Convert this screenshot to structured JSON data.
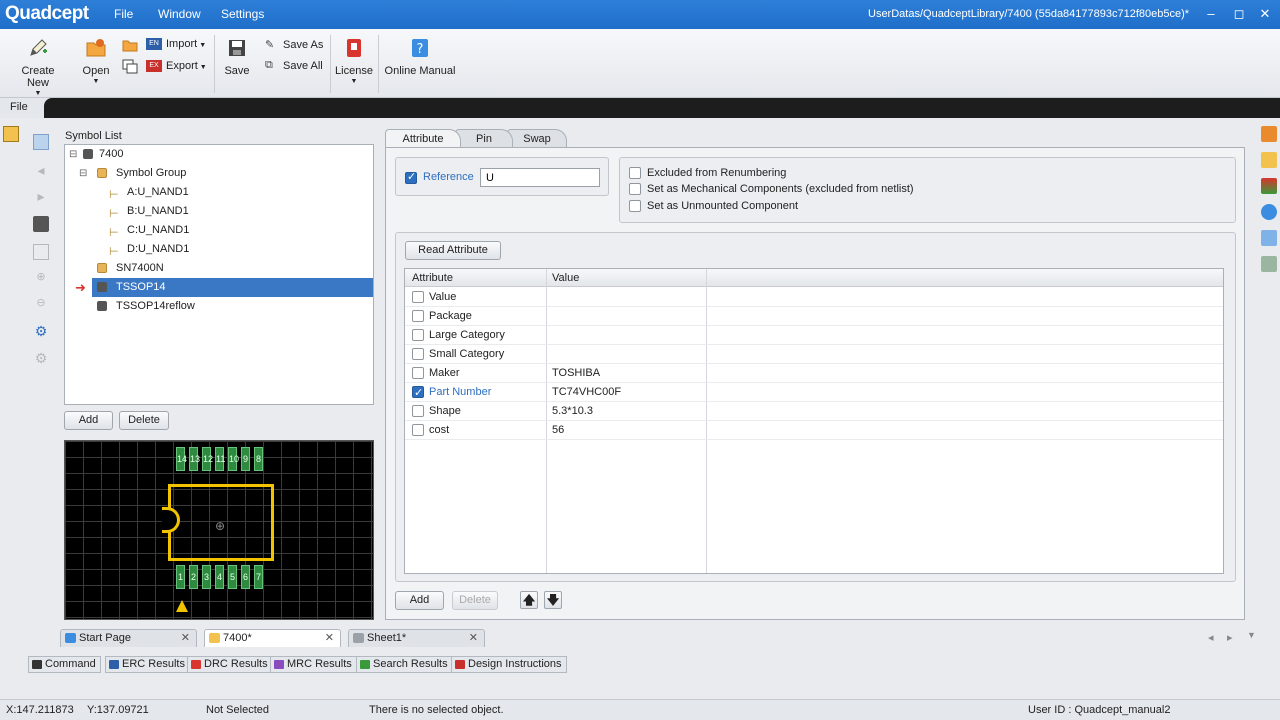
{
  "app": {
    "logo": "Quadcept",
    "menu": [
      "File",
      "Window",
      "Settings"
    ],
    "title_path": "UserDatas/QuadceptLibrary/7400 (55da84177893c712f80eb5ce)*"
  },
  "ribbon": {
    "create_new": "Create New",
    "open": "Open",
    "import": "Import",
    "export": "Export",
    "save": "Save",
    "save_as": "Save As",
    "save_all": "Save All",
    "license": "License",
    "online_manual": "Online Manual"
  },
  "file_tab": "File",
  "symbol_list": {
    "title": "Symbol List",
    "items": [
      {
        "label": "7400",
        "icon": "part-icon"
      },
      {
        "label": "Symbol Group",
        "icon": "folder-icon"
      },
      {
        "label": "A:U_NAND1",
        "icon": "pin-icon"
      },
      {
        "label": "B:U_NAND1",
        "icon": "pin-icon"
      },
      {
        "label": "C:U_NAND1",
        "icon": "pin-icon"
      },
      {
        "label": "D:U_NAND1",
        "icon": "pin-icon"
      },
      {
        "label": "SN7400N",
        "icon": "folder-icon"
      },
      {
        "label": "TSSOP14",
        "icon": "part-icon",
        "selected": true
      },
      {
        "label": "TSSOP14reflow",
        "icon": "part-icon"
      }
    ],
    "add": "Add",
    "delete": "Delete"
  },
  "preview": {
    "top_pins": [
      "14",
      "13",
      "12",
      "11",
      "10",
      "9",
      "8"
    ],
    "bottom_pins": [
      "1",
      "2",
      "3",
      "4",
      "5",
      "6",
      "7"
    ]
  },
  "tabs": [
    "Attribute",
    "Pin",
    "Swap"
  ],
  "reference": {
    "label": "Reference",
    "value": "U",
    "checked": true
  },
  "options": [
    {
      "label": "Excluded from Renumbering",
      "checked": false
    },
    {
      "label": "Set as Mechanical Components (excluded from netlist)",
      "checked": false
    },
    {
      "label": "Set as Unmounted Component",
      "checked": false
    }
  ],
  "read_attribute": "Read Attribute",
  "attr_table": {
    "headers": [
      "Attribute",
      "Value"
    ],
    "rows": [
      {
        "attribute": "Value",
        "value": "",
        "checked": false
      },
      {
        "attribute": "Package",
        "value": "",
        "checked": false
      },
      {
        "attribute": "Large Category",
        "value": "",
        "checked": false
      },
      {
        "attribute": "Small Category",
        "value": "",
        "checked": false
      },
      {
        "attribute": "Maker",
        "value": "TOSHIBA",
        "checked": false
      },
      {
        "attribute": "Part Number",
        "value": "TC74VHC00F",
        "checked": true
      },
      {
        "attribute": "Shape",
        "value": "5.3*10.3",
        "checked": false
      },
      {
        "attribute": "cost",
        "value": "56",
        "checked": false
      }
    ]
  },
  "attr_buttons": {
    "add": "Add",
    "delete": "Delete",
    "up": "🡅",
    "down": "🡇"
  },
  "doc_tabs": [
    {
      "label": "Start Page"
    },
    {
      "label": "7400*",
      "active": true
    },
    {
      "label": "Sheet1*"
    }
  ],
  "output_tabs": [
    "Command",
    "ERC Results",
    "DRC Results",
    "MRC Results",
    "Search Results",
    "Design Instructions"
  ],
  "status": {
    "x": "X:147.211873",
    "y": "Y:137.09721",
    "selection": "Not Selected",
    "message": "There is no selected object.",
    "user": "User ID : Quadcept_manual2"
  }
}
